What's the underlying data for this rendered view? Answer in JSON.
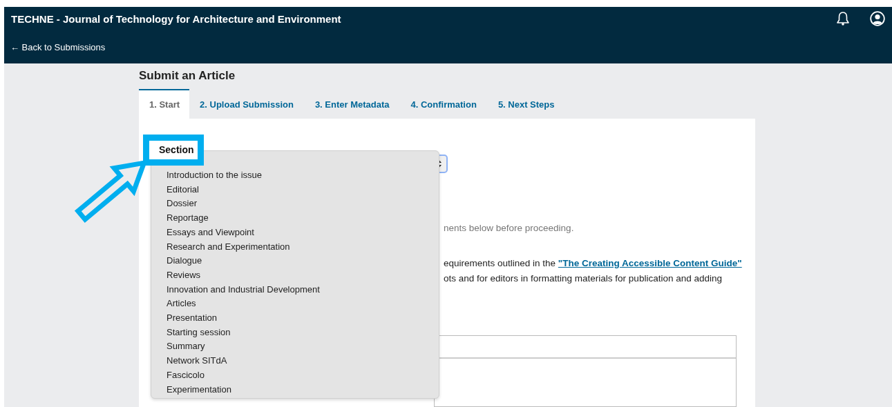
{
  "header": {
    "title": "TECHNE - Journal of Technology for Architecture and Environment",
    "back_link": "← Back to Submissions"
  },
  "page_title": "Submit an Article",
  "tabs": [
    {
      "label": "1. Start",
      "selected": true
    },
    {
      "label": "2. Upload Submission",
      "selected": false
    },
    {
      "label": "3. Enter Metadata",
      "selected": false
    },
    {
      "label": "4. Confirmation",
      "selected": false
    },
    {
      "label": "5. Next Steps",
      "selected": false
    }
  ],
  "section": {
    "label": "Section",
    "options": [
      {
        "label": "Introduction to the issue",
        "selected": false
      },
      {
        "label": "Editorial",
        "selected": false
      },
      {
        "label": "Dossier",
        "selected": false
      },
      {
        "label": "Reportage",
        "selected": false
      },
      {
        "label": "Essays and Viewpoint",
        "selected": false
      },
      {
        "label": "Research and Experimentation",
        "selected": false
      },
      {
        "label": "Dialogue",
        "selected": false
      },
      {
        "label": "Reviews",
        "selected": false
      },
      {
        "label": "Innovation and Industrial Development",
        "selected": false
      },
      {
        "label": "Articles",
        "selected": false
      },
      {
        "label": "Presentation",
        "selected": false
      },
      {
        "label": "Starting session",
        "selected": false
      },
      {
        "label": "Summary",
        "selected": false
      },
      {
        "label": "Network SITdA",
        "selected": false
      },
      {
        "label": "Fascicolo",
        "selected": false
      },
      {
        "label": "Experimentation",
        "selected": false
      }
    ]
  },
  "requirements_note": "nents below before proceeding.",
  "accessibility_text": {
    "before": "equirements outlined in the ",
    "link": "\"The Creating Accessible Content Guide\"",
    "after": "ots and for editors in formatting materials for publication and adding"
  }
}
